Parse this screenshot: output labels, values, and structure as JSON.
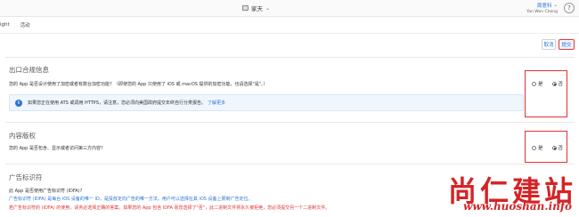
{
  "header": {
    "app_name": "家天",
    "app_chevron": "⌄",
    "user_name": "周意科",
    "user_chevron": "⌄",
    "user_sub": "Yan Wen Cheng",
    "help": "?"
  },
  "tabs": [
    "ight",
    "活动"
  ],
  "actions": {
    "cancel": "取消",
    "submit": "提交"
  },
  "export": {
    "title": "出口合规信息",
    "question": "您的 App 是否设计使用了加密或者有数台加密功能？（即使您的 App 只使用了 iOS 或 macOS 提供的加密功能，也请选择\"是\"。）",
    "info": "如果您正在使用 ATS 或调用 HTTPS，请注意，您必须向美国政府提交年终自行分类报告。",
    "info_link": "了解更多",
    "yes": "是",
    "no": "否",
    "selected": "no"
  },
  "content": {
    "title": "内容版权",
    "question": "您的 App 是否包含、显示或者访问第三方内容？",
    "yes": "是",
    "no": "否",
    "selected": "no"
  },
  "ads": {
    "title": "广告标识符",
    "line1": "此 App 是否使用广告标识符 (IDFA)?",
    "line2": "广告标识符 (IDFA) 是每台 iOS 设备的唯一 ID，是投放定向广告的唯一方法。用户可以选择在其 iOS 设备上限制广告定位。",
    "line3": "若广告标识符的 (IDFA) 的使用，请务必选择正确的答案。如果您的 App 包含 IDFA 而您选择了\"否\"，此二进制文件将永久被拒绝，您必须提交另一个二进制文件。"
  },
  "watermark": {
    "cn": "尚仁建站",
    "url": "www.huoshan.info"
  },
  "colors": {
    "accent": "#2a74d5",
    "highlight": "#e43030",
    "watermark": "#d42426"
  }
}
